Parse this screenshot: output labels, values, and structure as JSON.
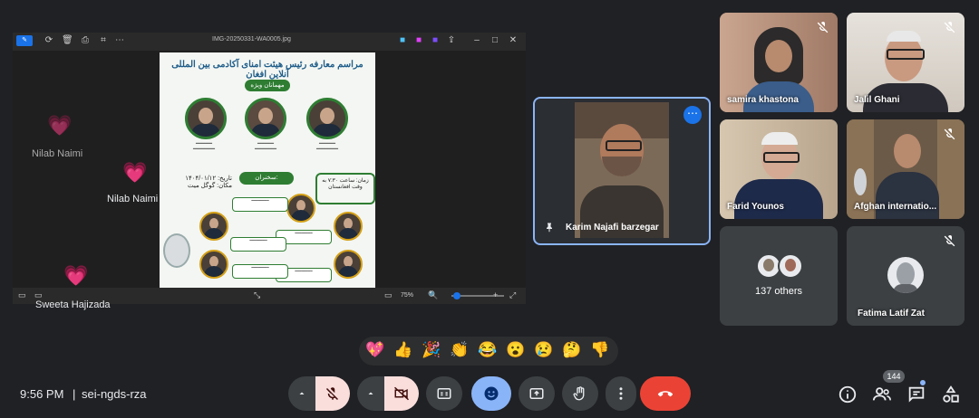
{
  "meeting": {
    "time": "9:56 PM",
    "separator": "|",
    "code": "sei-ngds-rza"
  },
  "presentation": {
    "filename": "IMG-20250331-WA0005.jpg",
    "zoom": "75%",
    "poster": {
      "title": "مراسم معارفه رئیس هیئت امنای آکادمی بین المللی آنلاین افغان",
      "badge": "مهمانان ویژه",
      "speakers_header": "سخنران:",
      "date_line": "تاریخ: ۱۴۰۴/۰۱/۱۲",
      "place_line": "مکان: گوگل میت",
      "time_line": "زمان: ساعت ۷:۳۰ به وقت افغانستان"
    }
  },
  "reactions": [
    {
      "emoji": "💗",
      "name": "Nilab Naimi",
      "dim": true
    },
    {
      "emoji": "💗",
      "name": "Nilab Naimi",
      "dim": false
    },
    {
      "emoji": "💗",
      "name": "Sweeta Hajizada",
      "dim": false
    }
  ],
  "tiles": {
    "main": {
      "name": "Karim Najafi barzegar",
      "more": "⋯"
    },
    "samira": {
      "name": "samira khastona"
    },
    "jalil": {
      "name": "Jalil Ghani"
    },
    "farid": {
      "name": "Farid Younos"
    },
    "afghan": {
      "name": "Afghan internatio..."
    },
    "others": {
      "label": "137 others"
    },
    "fatima": {
      "name": "Fatima Latif Zat"
    }
  },
  "emoji_bar": [
    "💖",
    "👍",
    "🎉",
    "👏",
    "😂",
    "😮",
    "😢",
    "🤔",
    "👎"
  ],
  "controls": {
    "people_count": "144",
    "colors": {
      "end_call": "#ea4335",
      "muted": "#f9dedc",
      "active": "#8ab4f8",
      "dark": "#3c4043"
    }
  }
}
